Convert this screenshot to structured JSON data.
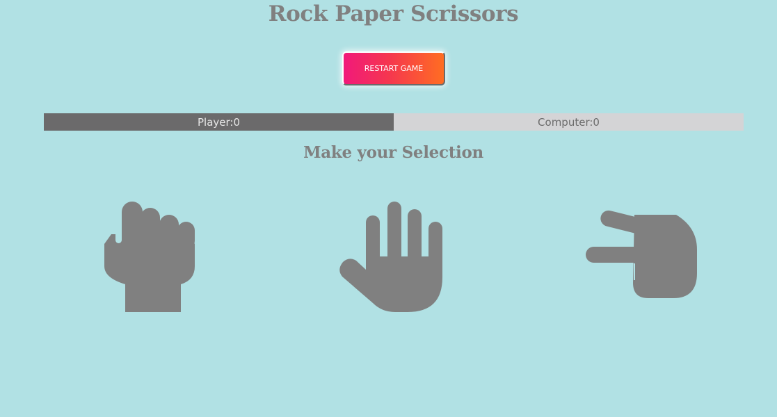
{
  "game": {
    "title": "Rock Paper Scrissors",
    "restart_label": "RESTART GAME",
    "subtitle": "Make your Selection"
  },
  "scoreboard": {
    "player_label": "Player:0",
    "computer_label": "Computer:0"
  },
  "choices": [
    {
      "name": "rock",
      "icon": "rock-hand-icon"
    },
    {
      "name": "paper",
      "icon": "paper-hand-icon"
    },
    {
      "name": "scissors",
      "icon": "scissors-hand-icon"
    }
  ],
  "colors": {
    "background": "#b1e1e4",
    "text": "#808080",
    "icon": "#808080",
    "player_bar": "#6b6a6b",
    "computer_bar": "#d4d4d6",
    "button_gradient_start": "#f1197b",
    "button_gradient_end": "#ff6d22"
  }
}
